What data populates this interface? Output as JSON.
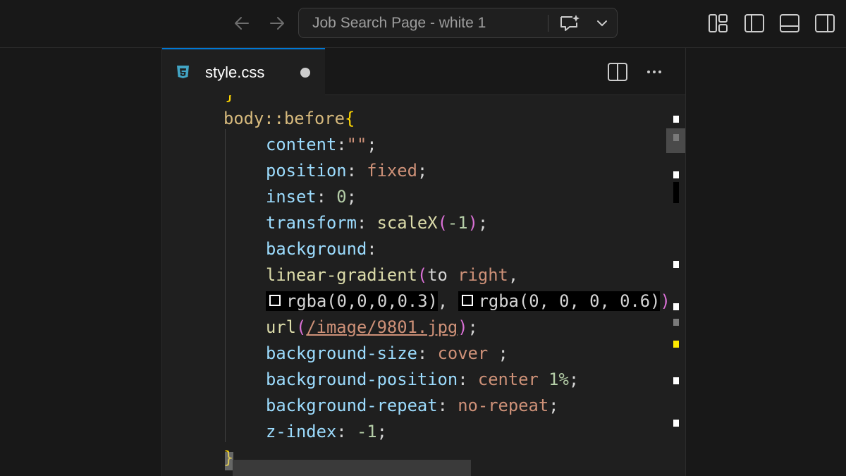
{
  "window": {
    "search_text": "Job Search Page - white 1"
  },
  "tab": {
    "filename": "style.css",
    "language_icon": "css3-icon",
    "dirty": true
  },
  "code": {
    "line1": {
      "selector": "body::before",
      "brace": "{"
    },
    "line2": {
      "prop": "content",
      "colon": ":",
      "value": "\"\"",
      "semi": ";"
    },
    "line3": {
      "prop": "position",
      "colon": ": ",
      "value": "fixed",
      "semi": ";"
    },
    "line4": {
      "prop": "inset",
      "colon": ": ",
      "value": "0",
      "semi": ";"
    },
    "line5": {
      "prop": "transform",
      "colon": ": ",
      "fn": "scaleX",
      "open": "(",
      "arg": "-1",
      "close": ")",
      "semi": ";"
    },
    "line6": {
      "prop": "background",
      "colon": ":"
    },
    "line7": {
      "fn": "linear-gradient",
      "open": "(",
      "arg1": "to",
      "arg2": "right",
      "comma": ","
    },
    "line8": {
      "color1": "rgba(0,0,0,0.3)",
      "sep1": ",",
      "color2": "rgba(0, 0, 0, 0.6)",
      "close": ")"
    },
    "line9": {
      "fn": "url",
      "open": "(",
      "path": "/image/9801.jpg",
      "close": ")",
      "semi": ";"
    },
    "line10": {
      "prop": "background-size",
      "colon": ": ",
      "value": "cover",
      "semi": " ;"
    },
    "line11": {
      "prop": "background-position",
      "colon": ": ",
      "value": "center",
      "num": "1%",
      "semi": ";"
    },
    "line12": {
      "prop": "background-repeat",
      "colon": ": ",
      "value": "no-repeat",
      "semi": ";"
    },
    "line13": {
      "prop": "z-index",
      "colon": ": ",
      "value": "-1",
      "semi": ";"
    },
    "line14": {
      "brace": "}"
    }
  },
  "colors": {
    "selector": "#d7ba7d",
    "property": "#9cdcfe",
    "value": "#ce9178",
    "number": "#b5cea8",
    "function": "#dcdcaa",
    "brace": "#ffd700",
    "accent": "#0078d4"
  }
}
